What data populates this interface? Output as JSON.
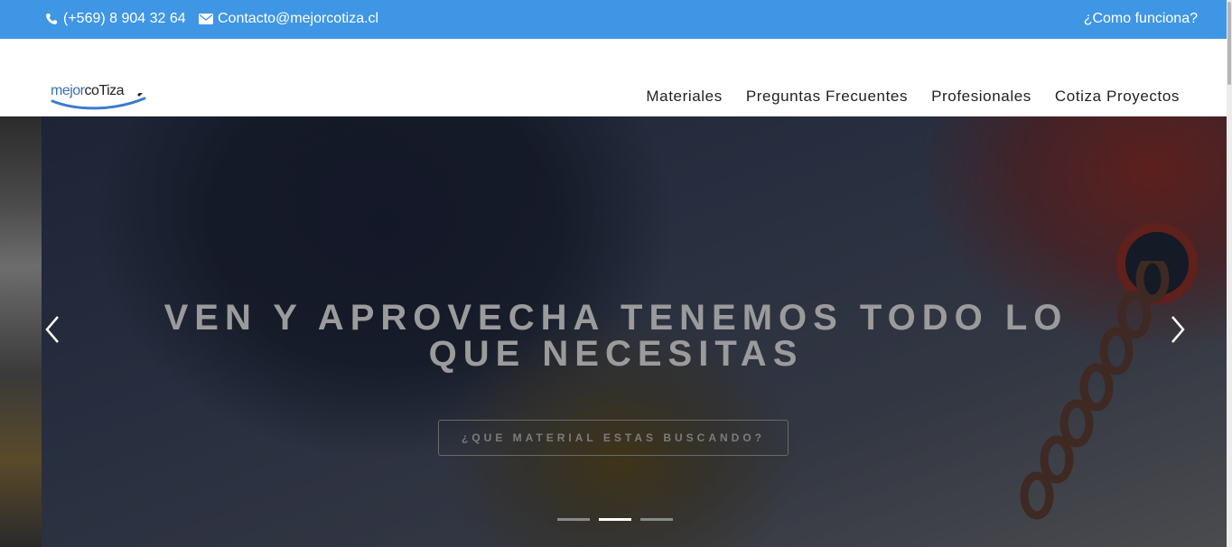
{
  "topbar": {
    "phone": "(+569) 8 904 32 64",
    "email": "Contacto@mejorcotiza.cl",
    "how_it_works": "¿Como funciona?",
    "phone_icon": "phone-icon",
    "email_icon": "envelope-icon",
    "bg_color": "#3f96e4"
  },
  "brand": {
    "part1": "mejor",
    "part2": "coTiza"
  },
  "nav": {
    "items": [
      "Materiales",
      "Preguntas Frecuentes",
      "Profesionales",
      "Cotiza Proyectos"
    ]
  },
  "hero": {
    "title_line1": "VEN Y APROVECHA TENEMOS TODO LO",
    "title_line2": "QUE NECESITAS",
    "button_label": "¿QUE MATERIAL ESTAS BUSCANDO?",
    "prev_icon": "chevron-left-icon",
    "next_icon": "chevron-right-icon",
    "slide_count": 3,
    "active_slide": 2
  }
}
